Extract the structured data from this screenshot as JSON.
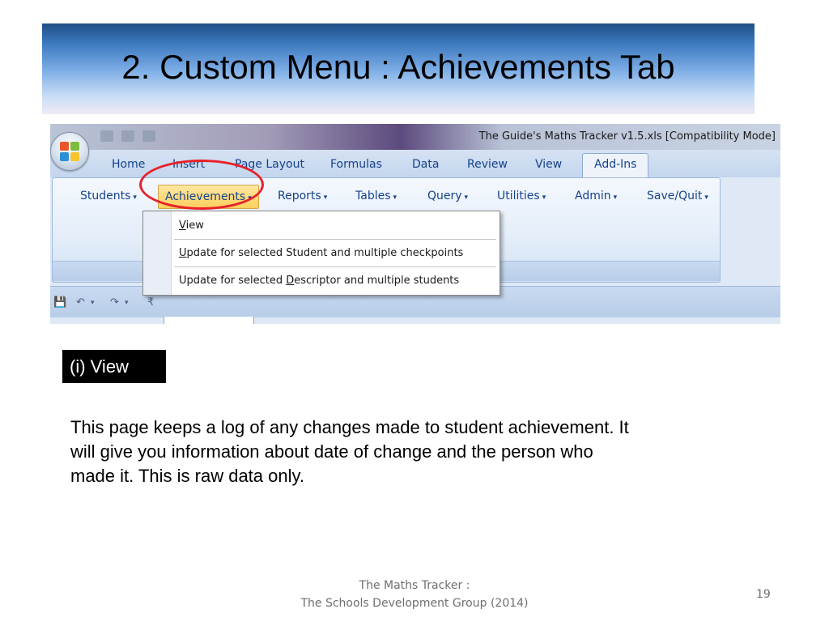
{
  "slide": {
    "title": "2.  Custom Menu :  Achievements Tab",
    "section_label": "(i) View",
    "description": "This page keeps a log of any changes made to student achievement.  It\nwill give you information about date of change and the person who\nmade it.   This is raw data  only.",
    "footer_line1": "The Maths Tracker :",
    "footer_line2": "The Schools Development Group  (2014)",
    "page_number": "19"
  },
  "excel": {
    "window_title": "The Guide's Maths Tracker v1.5.xls  [Compatibility Mode]",
    "tabs": [
      "Home",
      "Insert",
      "Page Layout",
      "Formulas",
      "Data",
      "Review",
      "View",
      "Add-Ins"
    ],
    "active_tab": "Add-Ins",
    "menu": [
      "Students",
      "Achievements",
      "Reports",
      "Tables",
      "Query",
      "Utilities",
      "Admin",
      "Save/Quit"
    ],
    "active_menu": "Achievements",
    "dropdown": {
      "view": {
        "mnemonic": "V",
        "rest": "iew"
      },
      "update_student": {
        "mnemonic": "U",
        "rest": "pdate for selected Student and multiple checkpoints"
      },
      "update_descriptor": {
        "prefix": "Update for selected ",
        "mnemonic": "D",
        "rest": "escriptor and multiple students"
      }
    },
    "caret_glyph": "▾",
    "qat_glyphs": {
      "save": "💾",
      "undo": "↶",
      "redo": "↷",
      "more": "▾",
      "customize": "₹"
    },
    "colors": {
      "highlight_ring": "#e8202a",
      "tab_text": "#15428b",
      "active_menu_fill": "#ffcf5c",
      "office_logo": [
        "#e8562a",
        "#7dbb3c",
        "#2c8fd6",
        "#f6c431"
      ]
    },
    "icons": {
      "office_button": "office-logo-icon",
      "save": "save-icon",
      "undo": "undo-icon",
      "redo": "redo-icon",
      "customize": "customize-qat-icon"
    }
  }
}
